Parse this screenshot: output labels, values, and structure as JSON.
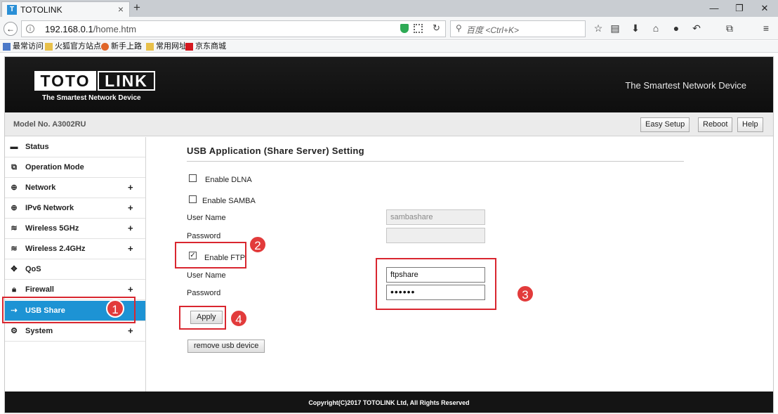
{
  "browser": {
    "tab_title": "TOTOLINK",
    "tab_favicon": "T",
    "url_host": "192.168.0.1",
    "url_path": "/home.htm",
    "search_placeholder": "百度 <Ctrl+K>",
    "bookmarks": [
      "最常访问",
      "火狐官方站点",
      "新手上路",
      "常用网址",
      "京东商城"
    ]
  },
  "header": {
    "logo_left": "TOTO",
    "logo_right": "LINK",
    "logo_tagline": "The Smartest Network Device",
    "slogan": "The Smartest Network Device"
  },
  "topbar": {
    "model": "Model No. A3002RU",
    "easy_setup": "Easy Setup",
    "reboot": "Reboot",
    "help": "Help"
  },
  "sidebar": {
    "items": [
      {
        "label": "Status",
        "icon": "chat-icon",
        "plus": ""
      },
      {
        "label": "Operation Mode",
        "icon": "window-icon",
        "plus": ""
      },
      {
        "label": "Network",
        "icon": "globe-icon",
        "plus": "+"
      },
      {
        "label": "IPv6 Network",
        "icon": "globe-icon",
        "plus": "+"
      },
      {
        "label": "Wireless 5GHz",
        "icon": "wifi-icon",
        "plus": "+"
      },
      {
        "label": "Wireless 2.4GHz",
        "icon": "wifi-icon",
        "plus": "+"
      },
      {
        "label": "QoS",
        "icon": "qos-icon",
        "plus": ""
      },
      {
        "label": "Firewall",
        "icon": "lock-icon",
        "plus": "+"
      },
      {
        "label": "USB Share",
        "icon": "usb-icon",
        "plus": ""
      },
      {
        "label": "System",
        "icon": "gear-icon",
        "plus": "+"
      }
    ],
    "active_item": "USB Share"
  },
  "main": {
    "title": "USB Application (Share Server) Setting",
    "dlna_label": "Enable DLNA",
    "dlna_checked": false,
    "samba_label": "Enable SAMBA",
    "samba_checked": false,
    "samba_user_label": "User Name",
    "samba_user_value": "sambashare",
    "samba_pass_label": "Password",
    "samba_pass_value": "",
    "ftp_label": "Enable FTP",
    "ftp_checked": true,
    "ftp_user_label": "User Name",
    "ftp_user_value": "ftpshare",
    "ftp_pass_label": "Password",
    "ftp_pass_value": "••••••",
    "apply_label": "Apply",
    "remove_label": "remove usb device"
  },
  "footer": {
    "copyright": "Copyright(C)2017 TOTOLINK Ltd, All Rights Reserved"
  },
  "annotations": {
    "markers": [
      "1",
      "2",
      "3",
      "4"
    ],
    "color": "#d9262f"
  },
  "colors": {
    "accent": "#1d93d4",
    "header_bg": "#141414",
    "annotation": "#e23b3b"
  }
}
